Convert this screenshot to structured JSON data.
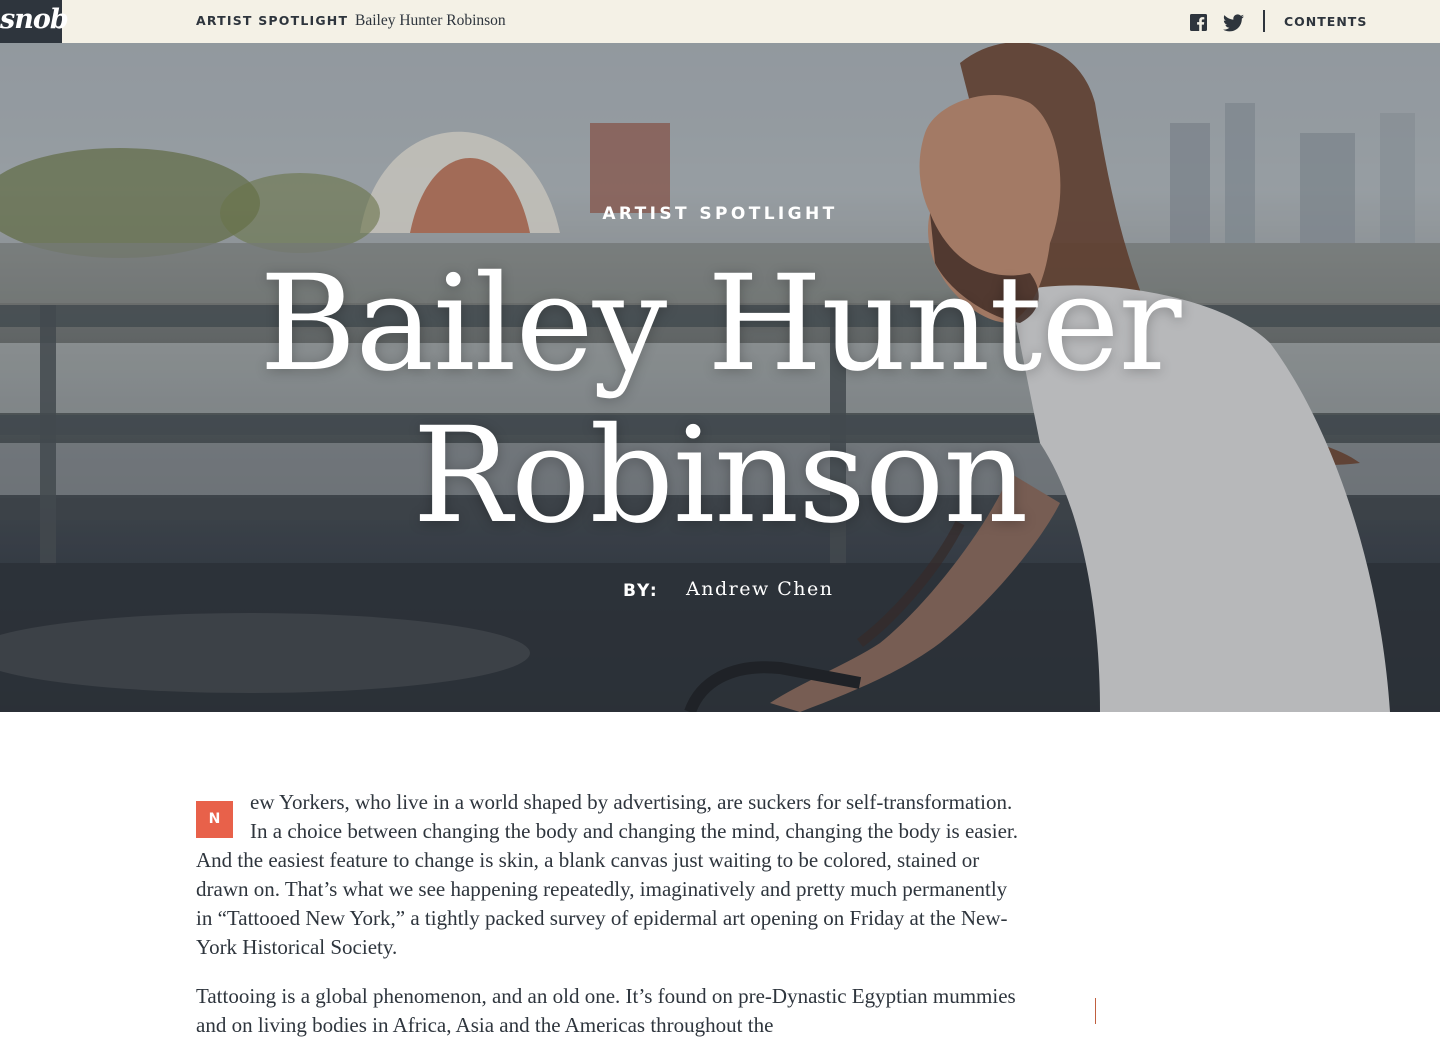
{
  "topbar": {
    "logo_text": "snob",
    "section_label": "ARTIST SPOTLIGHT",
    "article_title": "Bailey Hunter Robinson",
    "social_icons": [
      "facebook-icon",
      "twitter-icon"
    ],
    "contents_label": "CONTENTS"
  },
  "hero": {
    "kicker": "ARTIST SPOTLIGHT",
    "title": "Bailey Hunter Robinson",
    "byline_label": "BY:",
    "author": "Andrew Chen"
  },
  "article": {
    "drop_cap": "N",
    "paragraph_1": "ew Yorkers, who live in a world shaped by advertising, are suckers for self-transformation. In a choice between changing the body and changing the mind, changing the body is easier. And the easiest feature to change is skin, a blank canvas just waiting to be colored, stained or drawn on. That’s what we see happening repeatedly, imaginatively and pretty much permanently in “Tattooed New York,” a tightly packed survey of epidermal art opening on Friday at the New-York Historical Society.",
    "paragraph_2": "Tattooing is a global phenomenon, and an old one. It’s found on pre-Dynastic Egyptian mummies and on living bodies in Africa, Asia and the Americas throughout the"
  },
  "colors": {
    "topbar_bg": "#f4f1e6",
    "ink": "#2e353d",
    "accent": "#e8614a"
  }
}
